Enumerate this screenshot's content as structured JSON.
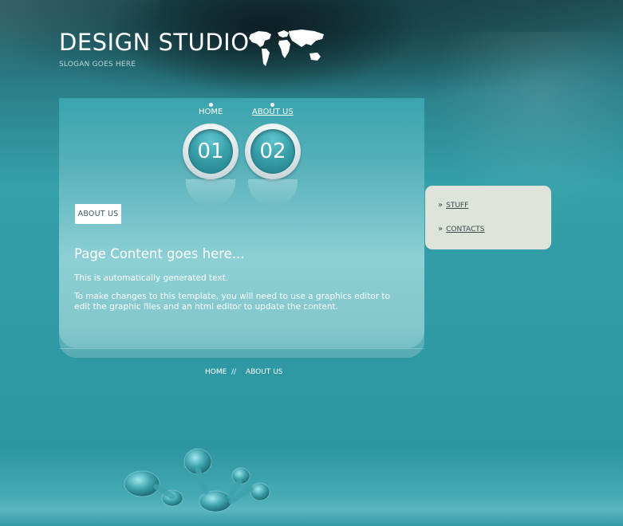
{
  "header": {
    "logo_text": "DESIGN STUDIO",
    "slogan": "SLOGAN GOES HERE",
    "logo_icon": "world-map-icon"
  },
  "nav": {
    "items": [
      {
        "label": "HOME",
        "number": "01",
        "active": false
      },
      {
        "label": "ABOUT US",
        "number": "02",
        "active": true
      }
    ]
  },
  "main": {
    "section_tag": "ABOUT US",
    "heading": "Page Content goes here...",
    "paragraphs": [
      "This is automatically generated text.",
      "To make changes to this template, you will need to use a graphics editor to edit the graphic files and an html editor to update the content."
    ]
  },
  "sidebar": {
    "items": [
      {
        "label": "STUFF",
        "icon": "double-chevron-right-icon"
      },
      {
        "label": "CONTACTS",
        "icon": "double-chevron-right-icon"
      }
    ]
  },
  "footer": {
    "home_label": "HOME",
    "separator": "//",
    "about_label": "ABOUT US"
  },
  "colors": {
    "background": "#2f9aa5",
    "panel": "#83c7cd",
    "sidebar": "#dfe4db",
    "text": "#ffffff"
  }
}
